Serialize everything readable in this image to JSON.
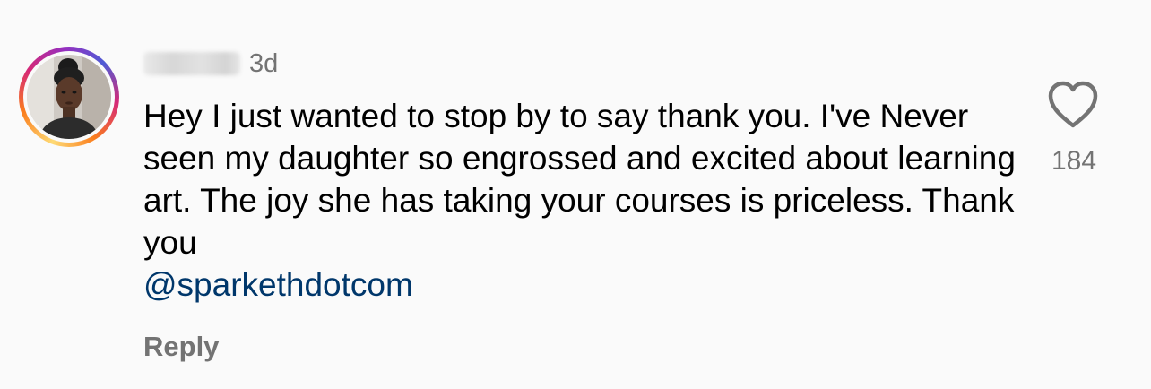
{
  "comment": {
    "username": "",
    "timestamp": "3d",
    "text": "Hey I just wanted to stop by to say thank you. I've Never seen my daughter so engrossed and excited about learning art. The joy she has taking your courses is priceless. Thank you",
    "mention": "@sparkethdotcom",
    "reply_label": "Reply",
    "like_count": "184"
  },
  "icons": {
    "like": "heart-icon",
    "avatar": "user-avatar"
  },
  "colors": {
    "text": "#000000",
    "meta": "#737373",
    "mention": "#00376b",
    "background": "#fafafa"
  }
}
